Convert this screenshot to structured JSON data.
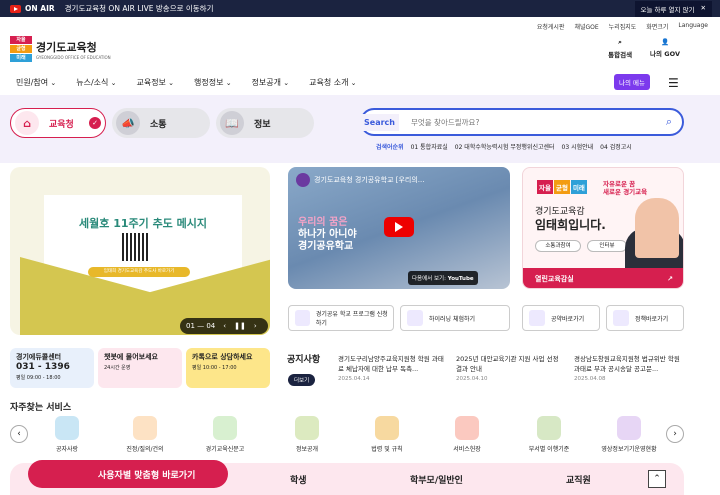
{
  "topbar": {
    "on_air": "ON AIR",
    "message": "경기도교육청 ON AIR LIVE 방송으로 이동하기",
    "close": "오늘 하루 열지 않기"
  },
  "util": [
    "요청게시판",
    "채널GOE",
    "누리집지도",
    "화면크기",
    "Language"
  ],
  "logo": {
    "badge": [
      "자율",
      "균형",
      "미래"
    ],
    "name": "경기도교육청",
    "sub": "GYEONGGIDO OFFICE OF EDUCATION"
  },
  "header_icons": [
    "통합검색",
    "나의 GOV"
  ],
  "nav": [
    "민원/참여",
    "뉴스/소식",
    "교육정보",
    "행정정보",
    "정보공개",
    "교육청 소개"
  ],
  "my_menu": "나의 메뉴",
  "pills": [
    "교육청",
    "소통",
    "정보"
  ],
  "search": {
    "label": "Search",
    "placeholder": "무엇을 찾아드릴까요?"
  },
  "keywords": {
    "title": "검색어순위",
    "items": [
      "01 통합자료실",
      "02 대학수학능력시험 무정행위신고센터",
      "03 시험안내",
      "04 검정고시"
    ]
  },
  "banner": {
    "title": "세월호 11주기 추도 메시지",
    "button": "임태희 경기도교육감 추도사 바로가기",
    "pager": "01 — 04"
  },
  "video": {
    "title": "경기도교육청 경기공유학교 [우리의...",
    "line1": "우리의 꿈은",
    "line2": "하나가 아니야",
    "line3": "경기공유학교",
    "watch": "다음에서 보기:",
    "yt": "YouTube"
  },
  "supt": {
    "badge": [
      "자율",
      "균형",
      "미래"
    ],
    "slogan1": "자유로운 꿈",
    "slogan2": "새로운 경기교육",
    "name1": "경기도교육감",
    "name2": "임태희입니다.",
    "btn1": "소통과참여",
    "btn2": "인터뷰",
    "bar": "열린교육감실"
  },
  "links": [
    "경기공유 학교 프로그램 신청하기",
    "하이러닝 체험하기",
    "공약바로가기",
    "정책바로가기"
  ],
  "quick": [
    {
      "t": "경기에듀콜센터",
      "v": "031 - 1396",
      "s": "평일 09:00 - 18:00"
    },
    {
      "t": "챗봇에 물어보세요",
      "s": "24시간 운영"
    },
    {
      "t": "카톡으로 상담하세요",
      "s": "평일 10:00 - 17:00"
    }
  ],
  "notice": {
    "title": "공지사항",
    "more": "더보기",
    "items": [
      {
        "t": "경기도구리남양주교육지원청 학원 과태료 체납자에 대한 납부 독촉...",
        "d": "2025.04.14"
      },
      {
        "t": "2025년 대안교육기관 지원 사업 선정 결과 안내",
        "d": "2025.04.10"
      },
      {
        "t": "경상남도창원교육지원청 법규위반 학원 과태료 부과 공시송달 공고문...",
        "d": "2025.04.08"
      }
    ]
  },
  "fav": {
    "title": "자주찾는 서비스",
    "items": [
      "공자사랑",
      "진정/질의/건의",
      "경기교육신문고",
      "정보공개",
      "법령 및 규칙",
      "서비스헌장",
      "부서별 이행기준",
      "영상정보기기운영현황"
    ]
  },
  "bottom": {
    "button": "사용자별 맞춤형 바로가기",
    "tabs": [
      "학생",
      "학부모/일반인",
      "교직원"
    ]
  }
}
